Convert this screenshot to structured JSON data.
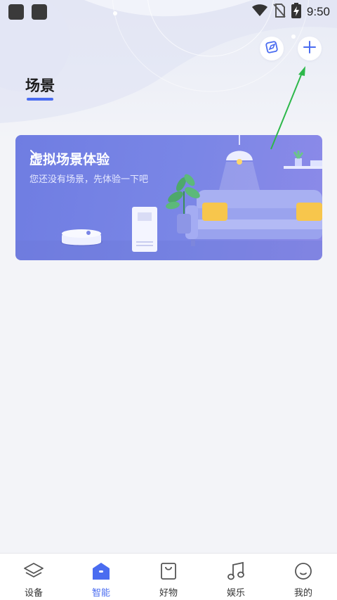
{
  "status_bar": {
    "time": "9:50",
    "icons": [
      "app-icon",
      "app-icon",
      "wifi-icon",
      "no-sim-icon",
      "battery-charging-icon"
    ]
  },
  "header": {
    "title": "场景",
    "buttons": [
      "compass-icon",
      "plus-icon"
    ]
  },
  "banner": {
    "title": "虚拟场景体验",
    "subtitle": "您还没有场景，先体验一下吧",
    "chevron": "chevron-right-icon"
  },
  "bottom_nav": {
    "active": "智能",
    "items": [
      {
        "label": "设备",
        "icon": "layers-icon"
      },
      {
        "label": "智能",
        "icon": "home-smart-icon"
      },
      {
        "label": "好物",
        "icon": "shopping-bag-icon"
      },
      {
        "label": "娱乐",
        "icon": "music-note-icon"
      },
      {
        "label": "我的",
        "icon": "profile-face-icon"
      }
    ]
  },
  "colors": {
    "accent": "#4a6cf0",
    "banner": "#7a86e6",
    "annotation_arrow": "#2db84a"
  }
}
